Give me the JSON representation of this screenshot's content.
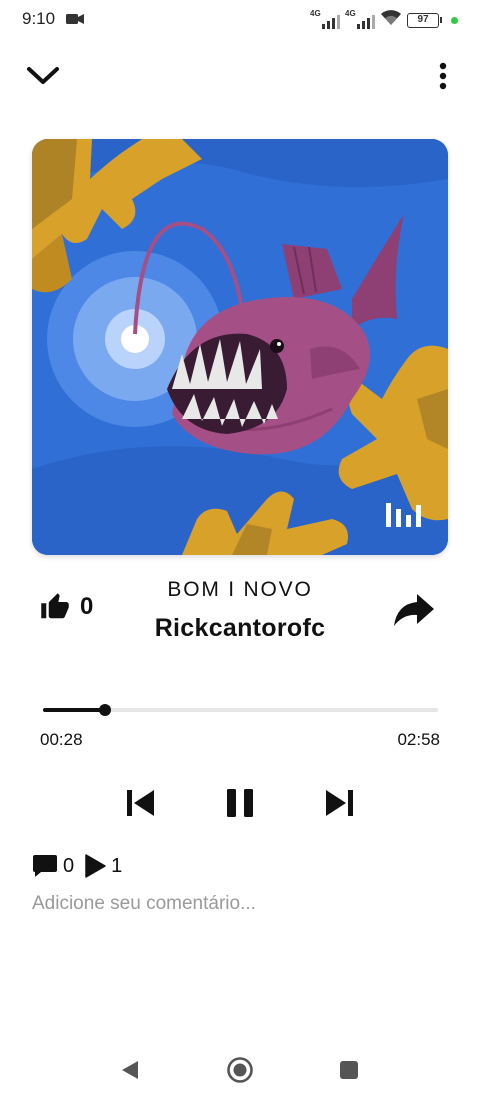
{
  "status_bar": {
    "time": "9:10",
    "network_1": "4G",
    "network_2": "4G",
    "battery": "97",
    "icons": [
      "video-camera-icon",
      "signal-icon",
      "signal-icon",
      "wifi-icon",
      "battery-icon",
      "active-dot"
    ]
  },
  "top_bar": {
    "collapse_icon": "chevron-down-icon",
    "menu_icon": "more-vert-icon"
  },
  "artwork": {
    "image": "anglerfish-illustration",
    "badge_icon": "audio-visualizer-icon",
    "colors": {
      "ocean": "#2f6fd6",
      "fish": "#a44f86",
      "coral": "#d8a12a"
    }
  },
  "track": {
    "title": "BOM I NOVO",
    "artist": "Rickcantorofc"
  },
  "likes": {
    "count": "0",
    "icon": "thumbs-up-icon"
  },
  "share": {
    "icon": "share-icon"
  },
  "progress": {
    "elapsed": "00:28",
    "total": "02:58",
    "fraction": 0.157
  },
  "controls": {
    "previous_icon": "skip-previous-icon",
    "playpause_icon": "pause-icon",
    "next_icon": "skip-next-icon"
  },
  "stats": {
    "comments": "0",
    "plays": "1"
  },
  "comment_box": {
    "placeholder": "Adicione seu comentário..."
  },
  "nav_bar": {
    "icons": [
      "back-icon",
      "home-icon",
      "recents-icon"
    ]
  }
}
